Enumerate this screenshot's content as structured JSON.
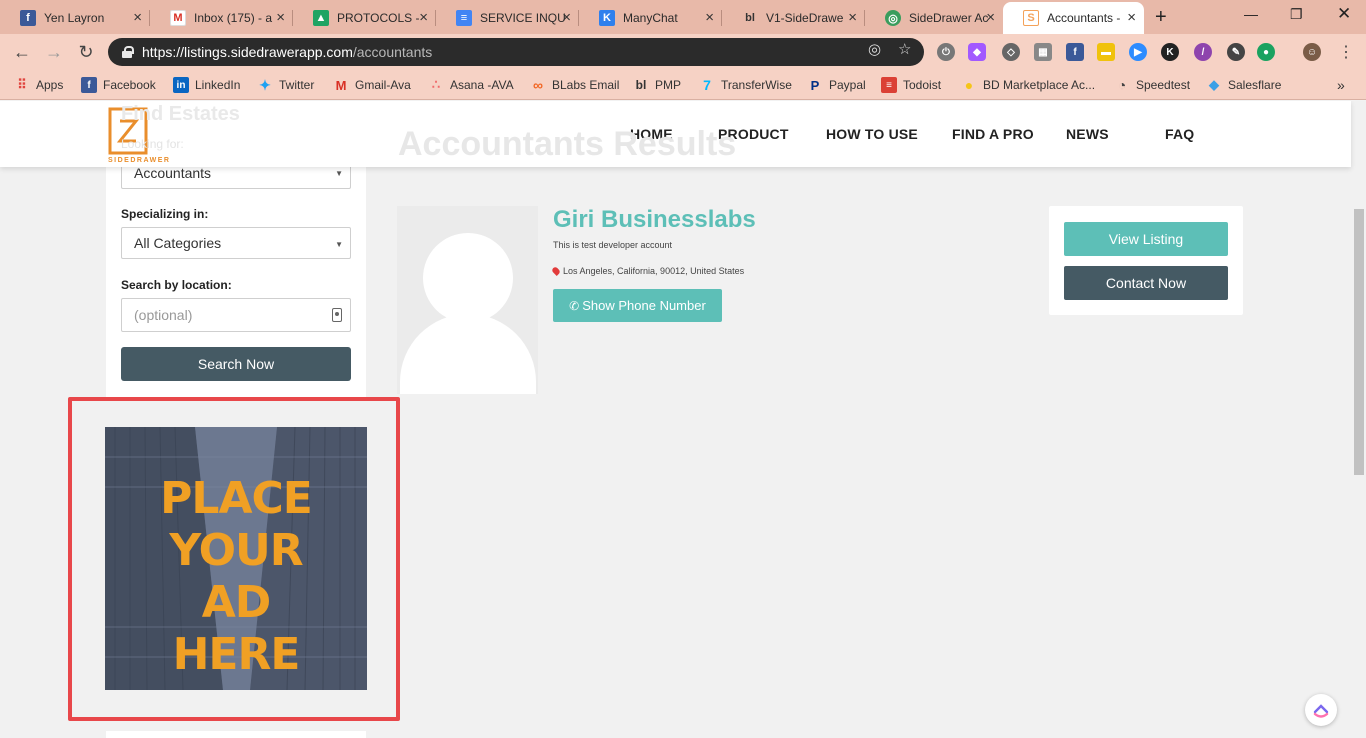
{
  "browser": {
    "tabs": [
      {
        "title": "Yen Layron",
        "icon": "facebook-icon",
        "color": "#3b5998",
        "glyph": "f"
      },
      {
        "title": "Inbox (175) - a",
        "icon": "gmail-icon",
        "color": "#d93025",
        "glyph": "M"
      },
      {
        "title": "PROTOCOLS -",
        "icon": "google-drive-icon",
        "color": "#1fa463",
        "glyph": "▲"
      },
      {
        "title": "SERVICE INQU",
        "icon": "google-docs-icon",
        "color": "#4285f4",
        "glyph": "≡"
      },
      {
        "title": "ManyChat",
        "icon": "manychat-icon",
        "color": "#2f80ed",
        "glyph": "K"
      },
      {
        "title": "V1-SideDrawe",
        "icon": "blabs-icon",
        "color": "#333333",
        "glyph": "bl"
      },
      {
        "title": "SideDrawer Ac",
        "icon": "globe-icon",
        "color": "#3a9d5d",
        "glyph": "◎"
      },
      {
        "title": "Accountants -",
        "icon": "sidedrawer-icon",
        "color": "#f4a259",
        "glyph": "S"
      }
    ],
    "url_host": "https://listings.sidedrawerapp.com",
    "url_path": "/accountants",
    "bookmarks": [
      {
        "label": "Apps",
        "icon": "apps-grid-icon",
        "color": "#e0443e",
        "glyph": "⋮⋮"
      },
      {
        "label": "Facebook",
        "icon": "facebook-icon",
        "color": "#3b5998",
        "glyph": "f"
      },
      {
        "label": "LinkedIn",
        "icon": "linkedin-icon",
        "color": "#0a66c2",
        "glyph": "in"
      },
      {
        "label": "Twitter",
        "icon": "twitter-icon",
        "color": "#1da1f2",
        "glyph": "t"
      },
      {
        "label": "Gmail-Ava",
        "icon": "gmail-icon",
        "color": "#d93025",
        "glyph": "M"
      },
      {
        "label": "Asana -AVA",
        "icon": "asana-icon",
        "color": "#f06a6a",
        "glyph": "∴"
      },
      {
        "label": "BLabs Email",
        "icon": "blabs-email-icon",
        "color": "#f26522",
        "glyph": "∞"
      },
      {
        "label": "PMP",
        "icon": "blabs-icon",
        "color": "#333333",
        "glyph": "bl"
      },
      {
        "label": "TransferWise",
        "icon": "transferwise-icon",
        "color": "#00b9ff",
        "glyph": "7"
      },
      {
        "label": "Paypal",
        "icon": "paypal-icon",
        "color": "#003087",
        "glyph": "P"
      },
      {
        "label": "Todoist",
        "icon": "todoist-icon",
        "color": "#db4035",
        "glyph": "≡"
      },
      {
        "label": "BD Marketplace Ac...",
        "icon": "lightbulb-icon",
        "color": "#f5c518",
        "glyph": "●"
      },
      {
        "label": "Speedtest",
        "icon": "speedtest-icon",
        "color": "#444444",
        "glyph": "◔"
      },
      {
        "label": "Salesflare",
        "icon": "salesflare-icon",
        "color": "#3aa0e6",
        "glyph": "◆"
      }
    ],
    "more_bookmarks": "»"
  },
  "site": {
    "brand": "SIDEDRAWER",
    "nav": [
      "HOME",
      "PRODUCT",
      "HOW TO USE",
      "FIND A PRO",
      "NEWS",
      "FAQ"
    ],
    "ghost_title": "Accountants Results",
    "ghost_side_title": "Find Estates",
    "ghost_side_sub": "Looking for:"
  },
  "sidebar": {
    "category_value": "Accountants",
    "specializing_label": "Specializing in:",
    "specializing_value": "All Categories",
    "location_label": "Search by location:",
    "location_placeholder": "(optional)",
    "search_button": "Search Now"
  },
  "ad": {
    "lines": [
      "PLACE",
      "YOUR",
      "AD",
      "HERE"
    ],
    "color": "#f0a024"
  },
  "result": {
    "name": "Giri Businesslabs",
    "description": "This is test developer account",
    "location": "Los Angeles, California, 90012, United States",
    "phone_button": "Show Phone Number",
    "view_button": "View Listing",
    "contact_button": "Contact Now"
  },
  "colors": {
    "teal": "#5dbfb7",
    "slate": "#455a64",
    "highlight": "#e8474a"
  }
}
